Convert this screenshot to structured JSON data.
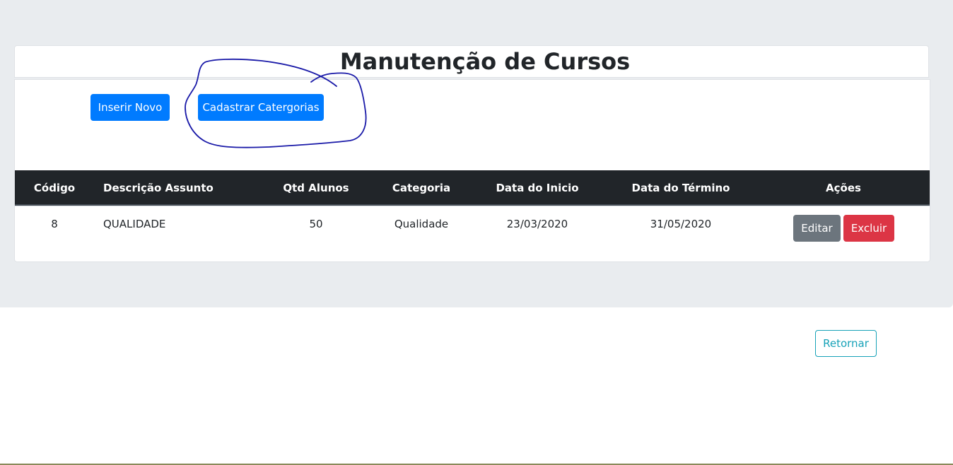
{
  "page": {
    "title": "Manutenção de Cursos"
  },
  "toolbar": {
    "insert_label": "Inserir Novo",
    "categories_label": "Cadastrar Catergorias"
  },
  "table": {
    "headers": [
      "Código",
      "Descrição Assunto",
      "Qtd Alunos",
      "Categoria",
      "Data do Inicio",
      "Data do Término",
      "Ações"
    ],
    "rows": [
      {
        "codigo": "8",
        "descricao": "QUALIDADE",
        "qtd_alunos": "50",
        "categoria": "Qualidade",
        "data_inicio": "23/03/2020",
        "data_termino": "31/05/2020",
        "edit_label": "Editar",
        "delete_label": "Excluir"
      }
    ]
  },
  "footer": {
    "return_label": "Retornar"
  },
  "colors": {
    "primary": "#007bff",
    "secondary": "#6c757d",
    "danger": "#dc3545",
    "info": "#17a2b8",
    "table_header": "#212529",
    "annotation_ink": "#1a1aa8"
  }
}
